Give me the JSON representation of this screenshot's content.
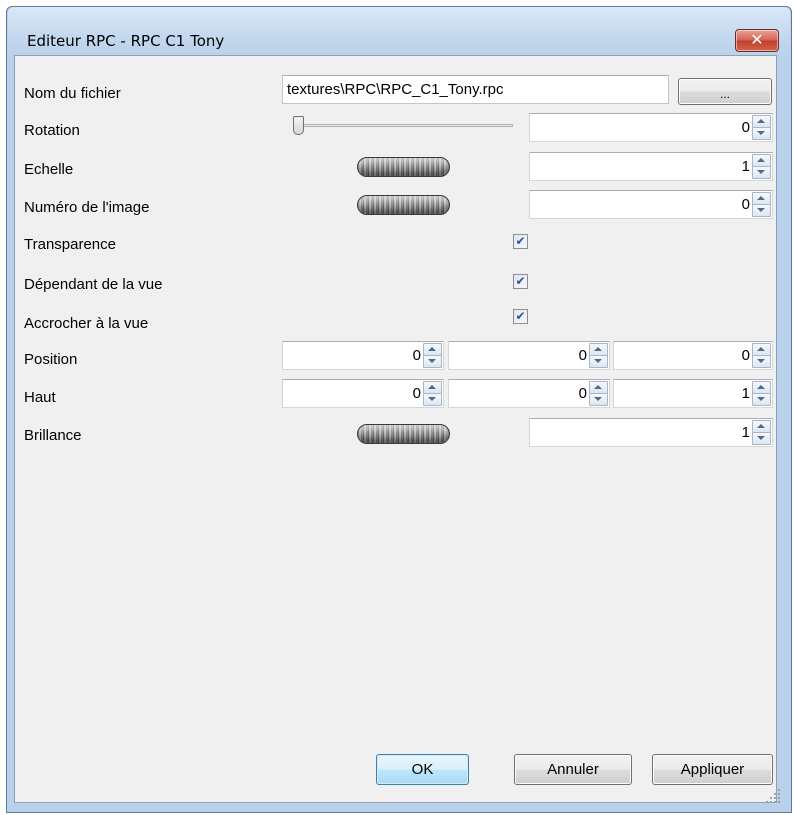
{
  "window": {
    "title": "Editeur RPC - RPC C1 Tony",
    "close_glyph": "✕"
  },
  "fields": {
    "filename": {
      "label": "Nom du fichier",
      "value": "textures\\RPC\\RPC_C1_Tony.rpc",
      "browse_label": "..."
    },
    "rotation": {
      "label": "Rotation",
      "value": "0",
      "slider_fraction": 0
    },
    "echelle": {
      "label": "Echelle",
      "value": "1"
    },
    "image": {
      "label": "Numéro de l'image",
      "value": "0"
    },
    "transparence": {
      "label": "Transparence",
      "checked": true
    },
    "dependant": {
      "label": "Dépendant de la vue",
      "checked": true
    },
    "accrocher": {
      "label": "Accrocher à la vue",
      "checked": true
    },
    "position": {
      "label": "Position",
      "x": "0",
      "y": "0",
      "z": "0"
    },
    "haut": {
      "label": "Haut",
      "x": "0",
      "y": "0",
      "z": "1"
    },
    "brillance": {
      "label": "Brillance",
      "value": "1"
    }
  },
  "check_glyph": "✔",
  "buttons": {
    "ok": "OK",
    "cancel": "Annuler",
    "apply": "Appliquer"
  },
  "colors": {
    "frame": "#b9d1ea",
    "client": "#f0f0f0",
    "close_button": "#c9472f",
    "default_button_border": "#3c7fb1"
  }
}
